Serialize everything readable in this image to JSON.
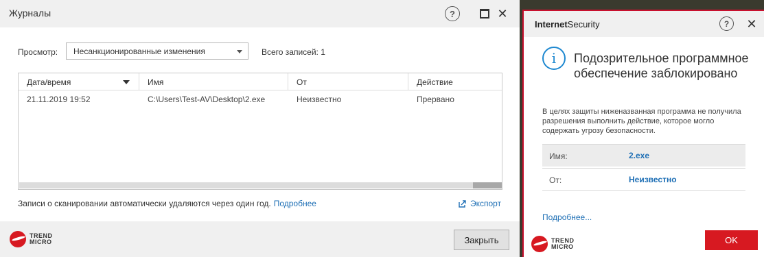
{
  "logs_window": {
    "title": "Журналы",
    "help_glyph": "?",
    "close_glyph": "✕",
    "view_label": "Просмотр:",
    "view_selected": "Несанкционированные изменения",
    "total_records": "Всего записей: 1",
    "table": {
      "columns": [
        "Дата/время",
        "Имя",
        "От",
        "Действие"
      ],
      "rows": [
        [
          "21.11.2019 19:52",
          "C:\\Users\\Test-AV\\Desktop\\2.exe",
          "Неизвестно",
          "Прервано"
        ]
      ]
    },
    "auto_delete_text": "Записи о сканировании автоматически удаляются через один год.",
    "auto_delete_link": "Подробнее",
    "export_label": "Экспорт",
    "close_button": "Закрыть"
  },
  "logo": {
    "line1": "TREND",
    "line2": "MICRO"
  },
  "alert_window": {
    "brand_bold": "Internet",
    "brand_rest": "Security",
    "help_glyph": "?",
    "close_glyph": "✕",
    "info_glyph": "i",
    "heading": "Подозрительное программное обеспечение заблокировано",
    "description": "В целях защиты ниженазванная программа не получила разрешения выполнить действие, которое могло содержать угрозу безопасности.",
    "name_label": "Имя:",
    "name_value": "2.exe",
    "from_label": "От:",
    "from_value": "Неизвестно",
    "more_link": "Подробнее...",
    "ok_button": "OK"
  },
  "colors": {
    "accent_link": "#1e6fb5",
    "alert_border": "#c8102e",
    "ok_button": "#d71921",
    "info_icon": "#1e88d0"
  },
  "icons": [
    "help-icon",
    "maximize-icon",
    "close-icon",
    "dropdown-arrow-icon",
    "sort-down-icon",
    "export-icon",
    "info-icon",
    "trend-micro-logo"
  ]
}
